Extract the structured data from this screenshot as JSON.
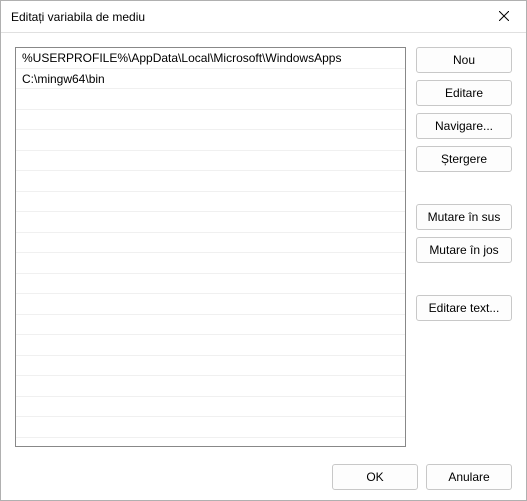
{
  "titlebar": {
    "title": "Editați variabila de mediu"
  },
  "list": {
    "rows": [
      "%USERPROFILE%\\AppData\\Local\\Microsoft\\WindowsApps",
      "C:\\mingw64\\bin"
    ]
  },
  "buttons": {
    "new": "Nou",
    "edit": "Editare",
    "browse": "Navigare...",
    "delete": "Ștergere",
    "move_up": "Mutare în sus",
    "move_down": "Mutare în jos",
    "edit_text": "Editare text..."
  },
  "footer": {
    "ok": "OK",
    "cancel": "Anulare"
  }
}
